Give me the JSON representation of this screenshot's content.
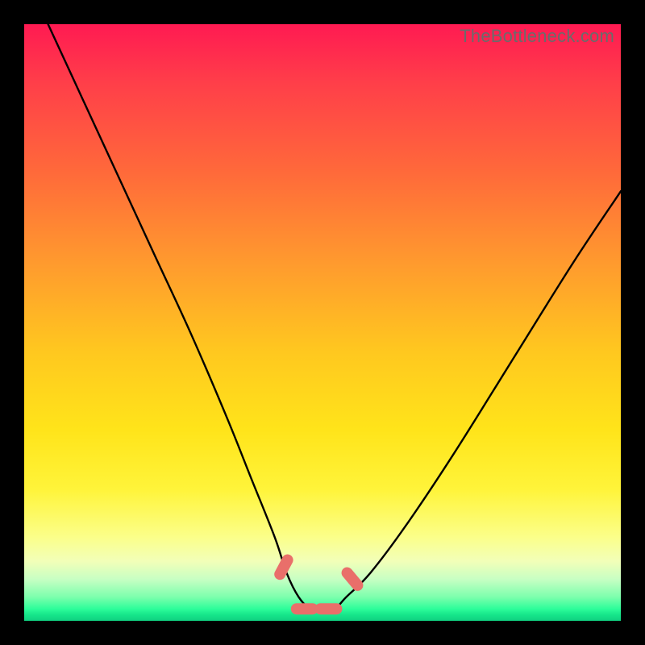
{
  "watermark": "TheBottleneck.com",
  "chart_data": {
    "type": "line",
    "title": "",
    "xlabel": "",
    "ylabel": "",
    "xlim": [
      0,
      100
    ],
    "ylim": [
      0,
      100
    ],
    "series": [
      {
        "name": "bottleneck-curve",
        "x": [
          4,
          10,
          16,
          22,
          28,
          34,
          38,
          42,
          44,
          46,
          48,
          50,
          52,
          54,
          58,
          64,
          72,
          82,
          92,
          100
        ],
        "values": [
          100,
          87,
          74,
          61,
          48,
          34,
          24,
          14,
          8,
          4,
          2,
          2,
          2,
          4,
          8,
          16,
          28,
          44,
          60,
          72
        ]
      }
    ],
    "annotations": [
      {
        "name": "marker-left-slope",
        "x": 43.5,
        "y": 9,
        "angle": -62
      },
      {
        "name": "marker-trough-1",
        "x": 47,
        "y": 2,
        "angle": 0
      },
      {
        "name": "marker-trough-2",
        "x": 51,
        "y": 2,
        "angle": 0
      },
      {
        "name": "marker-right-slope",
        "x": 55,
        "y": 7,
        "angle": 50
      }
    ],
    "gradient_stops": [
      {
        "pos": 0,
        "color": "#ff1a52"
      },
      {
        "pos": 55,
        "color": "#ffc81f"
      },
      {
        "pos": 90,
        "color": "#f2ffb8"
      },
      {
        "pos": 100,
        "color": "#10d181"
      }
    ]
  }
}
